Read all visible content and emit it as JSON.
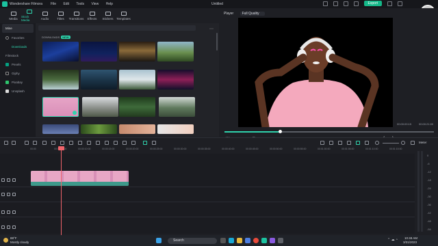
{
  "app": {
    "title": "Wondershare Filmora",
    "project": "Untitled",
    "export_label": "Export",
    "menu": [
      "File",
      "Edit",
      "Tools",
      "View",
      "Help"
    ]
  },
  "toolbar": {
    "items": [
      {
        "label": "Media",
        "icon": "media-icon"
      },
      {
        "label": "Stock Media",
        "icon": "stock-media-icon",
        "active": true
      },
      {
        "label": "Audio",
        "icon": "audio-icon"
      },
      {
        "label": "Titles",
        "icon": "titles-icon"
      },
      {
        "label": "Transitions",
        "icon": "transitions-icon"
      },
      {
        "label": "Effects",
        "icon": "effects-icon"
      },
      {
        "label": "Stickers",
        "icon": "stickers-icon"
      },
      {
        "label": "Templates",
        "icon": "templates-icon"
      }
    ]
  },
  "sidebar": {
    "head": "Mine",
    "items": [
      "Favorites",
      "Downloads",
      "Filmstock",
      "Pexels",
      "Giphy",
      "Pixabay",
      "Unsplash"
    ]
  },
  "media": {
    "section": "DOWNLOADS",
    "badge": "NEW"
  },
  "player": {
    "tab": "Player",
    "quality": "Full Quality",
    "current": "00:00:00:15",
    "total": "00:00:21:00"
  },
  "timeline": {
    "ticks": [
      "00:00",
      "00:00:05:00",
      "00:00:10:00",
      "00:00:15:00",
      "00:00:20:00",
      "00:00:25:00",
      "00:00:30:00",
      "00:00:35:00",
      "00:00:40:00",
      "00:00:45:00",
      "00:00:50:00",
      "00:00:55:00",
      "00:01:00:00",
      "00:01:05:00",
      "00:01:10:00",
      "00:01:15:00"
    ],
    "meter_label": "Meter",
    "meter_scale": [
      "0",
      "-6",
      "-12",
      "-18",
      "-24",
      "-30",
      "-36",
      "-42",
      "-48",
      "-54"
    ]
  },
  "taskbar": {
    "weather_temp": "88°F",
    "weather_desc": "Mostly cloudy",
    "search": "Search",
    "time": "10:48 AM",
    "date": "3/31/2023"
  },
  "colors": {
    "accent": "#2fd3ad",
    "playhead": "#f1646b",
    "clip": "#50b5a5",
    "export": "#15b889"
  }
}
